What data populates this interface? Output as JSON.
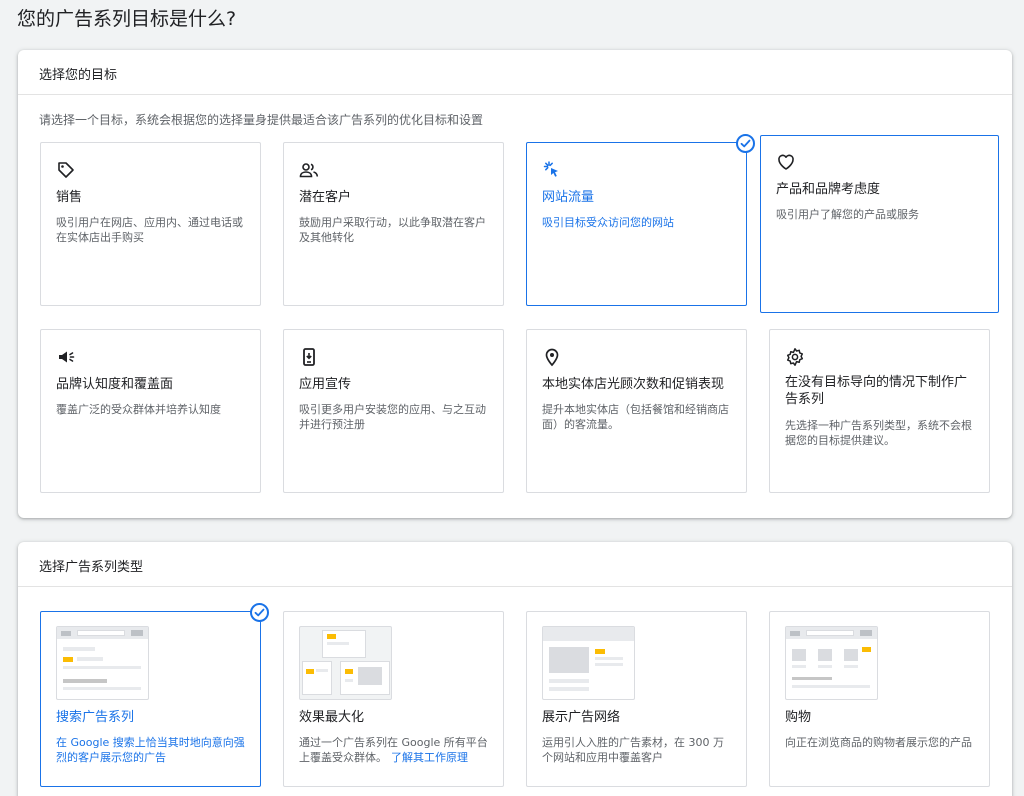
{
  "page_title": "您的广告系列目标是什么?",
  "goal_section": {
    "header": "选择您的目标",
    "description": "请选择一个目标，系统会根据您的选择量身提供最适合该广告系列的优化目标和设置",
    "cards": [
      {
        "title": "销售",
        "desc": "吸引用户在网店、应用内、通过电话或在实体店出手购买",
        "icon": "tag-icon",
        "selected": false
      },
      {
        "title": "潜在客户",
        "desc": "鼓励用户采取行动，以此争取潜在客户及其他转化",
        "icon": "people-icon",
        "selected": false
      },
      {
        "title": "网站流量",
        "desc": "吸引目标受众访问您的网站",
        "icon": "cursor-click-icon",
        "selected": true
      },
      {
        "title": "产品和品牌考虑度",
        "desc": "吸引用户了解您的产品或服务",
        "icon": "heart-icon",
        "selected": false
      },
      {
        "title": "品牌认知度和覆盖面",
        "desc": "覆盖广泛的受众群体并培养认知度",
        "icon": "megaphone-icon",
        "selected": false
      },
      {
        "title": "应用宣传",
        "desc": "吸引更多用户安装您的应用、与之互动并进行预注册",
        "icon": "phone-icon",
        "selected": false
      },
      {
        "title": "本地实体店光顾次数和促销表现",
        "desc": "提升本地实体店（包括餐馆和经销商店面）的客流量。",
        "icon": "location-pin-icon",
        "selected": false
      },
      {
        "title": "在没有目标导向的情况下制作广告系列",
        "desc": "先选择一种广告系列类型，系统不会根据您的目标提供建议。",
        "icon": "gear-icon",
        "selected": false
      }
    ]
  },
  "type_section": {
    "header": "选择广告系列类型",
    "cards": [
      {
        "title": "搜索广告系列",
        "desc": "在 Google 搜索上恰当其时地向意向强烈的客户展示您的广告",
        "selected": true
      },
      {
        "title": "效果最大化",
        "desc": "通过一个广告系列在 Google 所有平台上覆盖受众群体。",
        "link": "了解其工作原理",
        "selected": false
      },
      {
        "title": "展示广告网络",
        "desc": "运用引人入胜的广告素材，在 300 万个网站和应用中覆盖客户",
        "selected": false
      },
      {
        "title": "购物",
        "desc": "向正在浏览商品的购物者展示您的产品",
        "selected": false
      }
    ]
  },
  "colors": {
    "accent": "#1a73e8",
    "thumb_accent": "#fbbc04",
    "border": "#dadce0"
  }
}
